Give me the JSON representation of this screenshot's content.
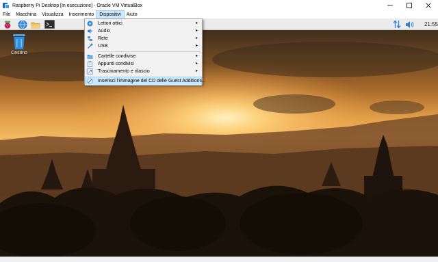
{
  "window": {
    "title": "Raspberry Pi Desktop [In esecuzione] - Oracle VM VirtualBox",
    "icon": "virtualbox-icon",
    "controls": [
      "minimize-icon",
      "maximize-icon",
      "close-icon"
    ]
  },
  "menubar": {
    "items": [
      {
        "label": "File"
      },
      {
        "label": "Macchina"
      },
      {
        "label": "Visualizza"
      },
      {
        "label": "Inserimento"
      },
      {
        "label": "Dispositivi",
        "active": true
      },
      {
        "label": "Aiuto"
      }
    ]
  },
  "dropdown": {
    "items": [
      {
        "label": "Lettori ottici",
        "icon": "optical-disc-icon",
        "submenu": true
      },
      {
        "label": "Audio",
        "icon": "audio-icon",
        "submenu": true
      },
      {
        "label": "Rete",
        "icon": "network-icon",
        "submenu": true
      },
      {
        "label": "USB",
        "icon": "usb-icon",
        "submenu": true
      },
      {
        "label": "Cartelle condivise",
        "icon": "shared-folder-icon",
        "submenu": true
      },
      {
        "label": "Appunti condivisi",
        "icon": "clipboard-icon",
        "submenu": true
      },
      {
        "label": "Trascinamento e rilascio",
        "icon": "drag-drop-icon",
        "submenu": true
      },
      {
        "label": "Inserisci l'immagine del CD delle Guest Additions...",
        "icon": "guest-additions-icon",
        "submenu": false,
        "highlighted": true
      }
    ],
    "arrow": "▸"
  },
  "guest": {
    "taskbar": {
      "icons": [
        "raspberry-menu-icon",
        "web-browser-icon",
        "file-manager-icon",
        "terminal-icon"
      ],
      "tray": [
        "network-transfer-icon",
        "volume-icon"
      ],
      "clock": "21:55"
    },
    "desktop": {
      "trash_label": "Cestino"
    }
  },
  "colors": {
    "menu_highlight": "#cce8ff",
    "menu_highlight_border": "#99d1ff",
    "tray_blue": "#2a7fd4",
    "sky_top": "#3a2a1c",
    "sun": "#ffd27a"
  }
}
